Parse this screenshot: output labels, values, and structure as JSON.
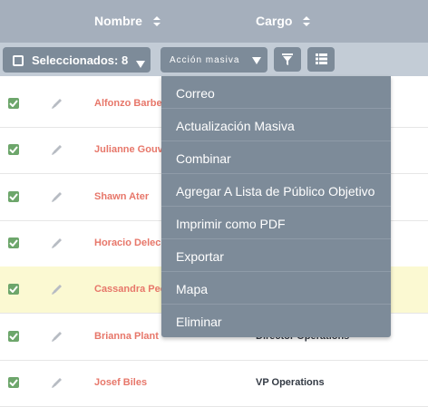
{
  "header": {
    "col_nombre": "Nombre",
    "col_cargo": "Cargo"
  },
  "toolbar": {
    "selected_label": "Seleccionados: 8",
    "mass_action_label": "Acción masiva"
  },
  "rows": [
    {
      "name": "Alfonzo Barbe",
      "cargo": "",
      "highlight": false
    },
    {
      "name": "Julianne Gouv",
      "cargo": "",
      "highlight": false
    },
    {
      "name": "Shawn Ater",
      "cargo": "",
      "highlight": false
    },
    {
      "name": "Horacio Delec",
      "cargo": "",
      "highlight": false
    },
    {
      "name": "Cassandra Pec",
      "cargo": "",
      "highlight": true
    },
    {
      "name": "Brianna Plant",
      "cargo": "Director Operations",
      "highlight": false
    },
    {
      "name": "Josef Biles",
      "cargo": "VP Operations",
      "highlight": false
    }
  ],
  "menu": {
    "items": [
      "Correo",
      "Actualización Masiva",
      "Combinar",
      "Agregar A Lista de Público Objetivo",
      "Imprimir como PDF",
      "Exportar",
      "Mapa",
      "Eliminar"
    ]
  },
  "colors": {
    "header_bg": "#a5afbc",
    "toolbar_bg": "#c3ccd6",
    "button_bg": "#7d8b99",
    "name_link": "#e7776a",
    "checkbox": "#6da66b",
    "highlight_row": "#fbf9d2"
  },
  "icons": {
    "sort": "sort-icon",
    "filter": "filter-icon",
    "columns": "columns-icon",
    "edit": "pencil-icon",
    "check": "check-icon",
    "caret": "caret-down-icon"
  }
}
